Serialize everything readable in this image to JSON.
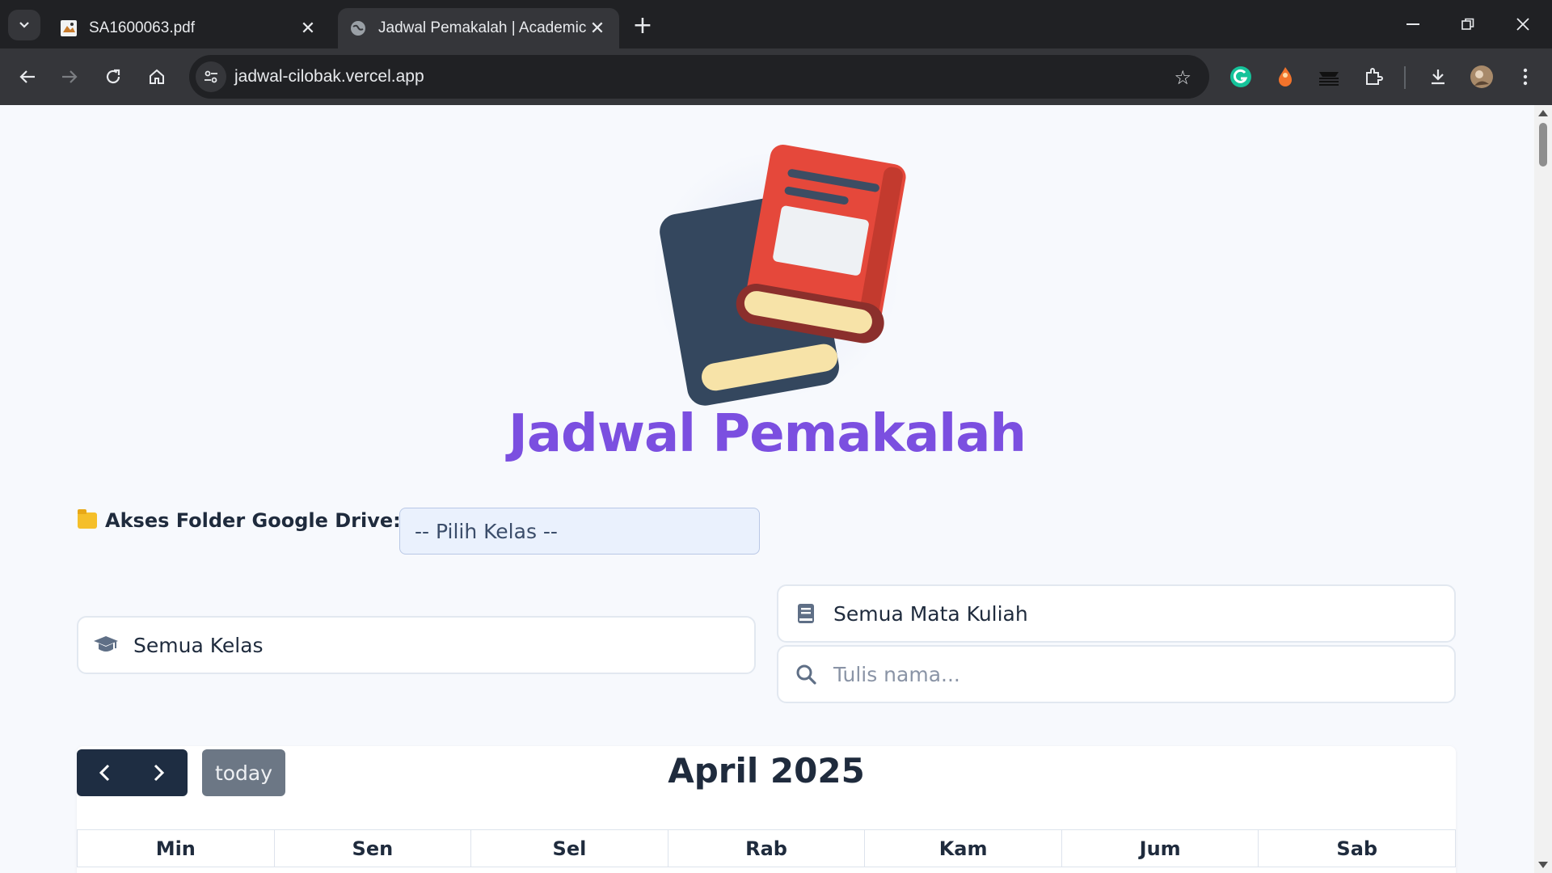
{
  "browser": {
    "tabs": [
      {
        "title": "SA1600063.pdf",
        "icon": "pdf-icon"
      },
      {
        "title": "Jadwal Pemakalah | Academic P",
        "icon": "globe-icon"
      }
    ],
    "new_tab": "+",
    "url": "jadwal-cilobak.vercel.app"
  },
  "page": {
    "title": "Jadwal Pemakalah",
    "title_color": "#7b4fe0",
    "drive": {
      "label": "Akses Folder Google Drive:",
      "select_value": "-- Pilih Kelas --"
    },
    "filters": {
      "kelas": "Semua Kelas",
      "mata_kuliah": "Semua Mata Kuliah",
      "search_placeholder": "Tulis nama..."
    },
    "calendar": {
      "today_label": "today",
      "title": "April 2025",
      "days": [
        "Min",
        "Sen",
        "Sel",
        "Rab",
        "Kam",
        "Jum",
        "Sab"
      ]
    }
  }
}
